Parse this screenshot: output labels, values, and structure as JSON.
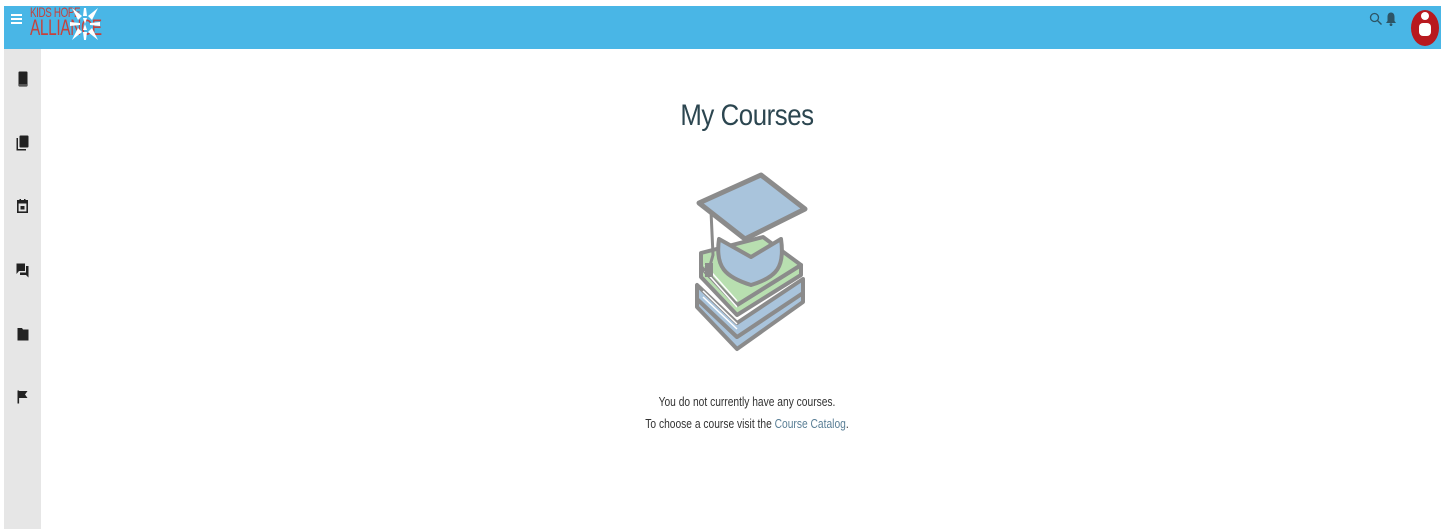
{
  "header": {
    "logo_line1": "KIDS HOPE",
    "logo_line2": "ALLIANCE",
    "accent_color": "#49b6e6",
    "icons": [
      "menu-icon",
      "search-icon",
      "bell-icon",
      "avatar"
    ]
  },
  "sidebar": {
    "items": [
      {
        "name": "sidebar-item-my-courses",
        "icon": "book-icon"
      },
      {
        "name": "sidebar-item-course-catalog",
        "icon": "library-icon"
      },
      {
        "name": "sidebar-item-calendar",
        "icon": "calendar-icon"
      },
      {
        "name": "sidebar-item-messages",
        "icon": "chat-icon"
      },
      {
        "name": "sidebar-item-files",
        "icon": "folder-icon"
      },
      {
        "name": "sidebar-item-reports",
        "icon": "flag-icon"
      }
    ]
  },
  "main": {
    "title": "My Courses",
    "empty_line1": "You do not currently have any courses.",
    "empty_line2_prefix": "To choose a course visit the ",
    "empty_link": "Course Catalog",
    "empty_line2_suffix": "."
  }
}
